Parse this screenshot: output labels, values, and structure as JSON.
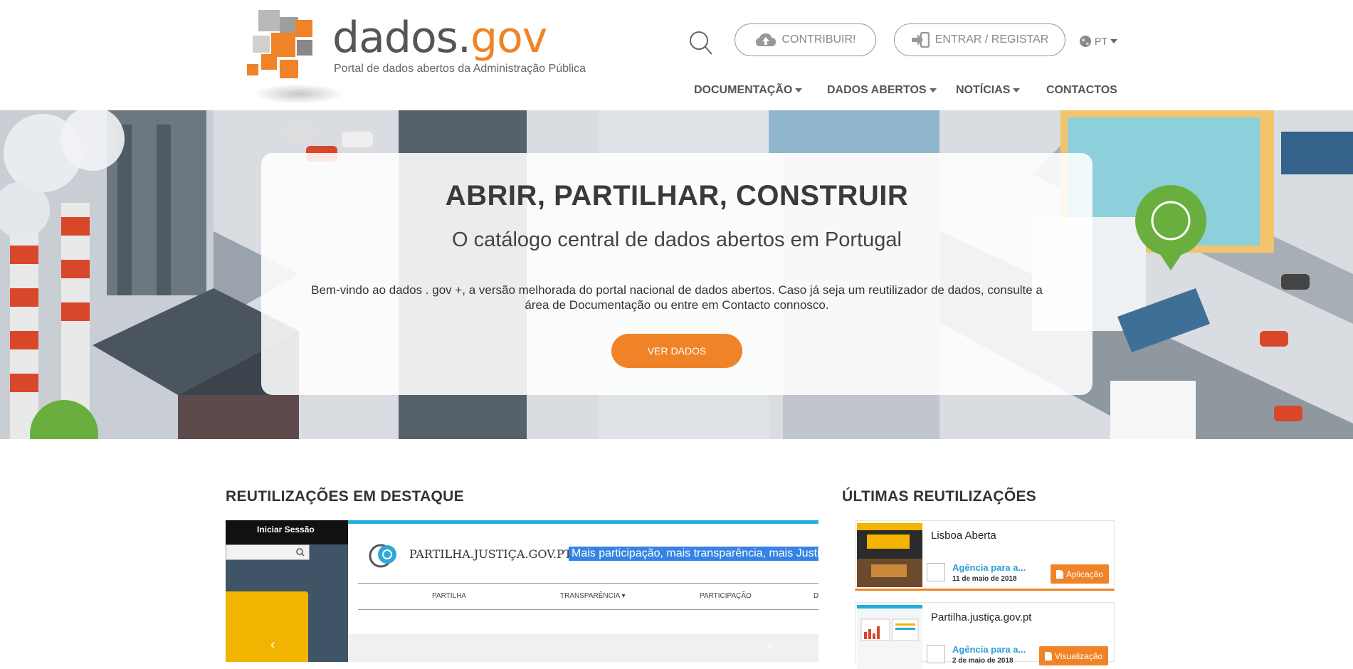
{
  "header": {
    "logo_word_main": "dados.",
    "logo_word_gov": "gov",
    "logo_tagline": "Portal de dados abertos da Administração Pública",
    "contribute_label": "CONTRIBUIR!",
    "login_label": "ENTRAR / REGISTAR",
    "language": "PT",
    "nav": [
      {
        "label": "DOCUMENTAÇÃO",
        "has_dropdown": true
      },
      {
        "label": "DADOS ABERTOS",
        "has_dropdown": true
      },
      {
        "label": "NOTÍCIAS",
        "has_dropdown": true
      },
      {
        "label": "CONTACTOS",
        "has_dropdown": false
      }
    ]
  },
  "hero": {
    "title": "ABRIR, PARTILHAR, CONSTRUIR",
    "subtitle": "O catálogo central de dados abertos em Portugal",
    "description": "Bem-vindo ao dados . gov +, a versão melhorada do portal nacional de dados abertos. Caso já seja um reutilizador de dados, consulte a área de Documentação ou entre em Contacto connosco.",
    "cta_label": "VER DADOS"
  },
  "featured": {
    "title": "REUTILIZAÇÕES EM DESTAQUE",
    "slide": {
      "login_label": "Iniciar Sessão",
      "brand": "PARTILHA.JUSTIÇA.GOV.PT",
      "highlight": "Mais participação, mais transparência, mais Justiça",
      "nav": [
        "PARTILHA",
        "TRANSPARÊNCIA ▾",
        "PARTICIPAÇÃO",
        "D"
      ]
    },
    "prev_arrow": "‹",
    "next_arrow": "›"
  },
  "latest": {
    "title": "ÚLTIMAS REUTILIZAÇÕES",
    "items": [
      {
        "name": "Lisboa Aberta",
        "org": "Agência para a...",
        "date": "11 de maio de 2018",
        "badge": "Aplicação"
      },
      {
        "name": "Partilha.justiça.gov.pt",
        "org": "Agência para a...",
        "date": "2 de maio de 2018",
        "badge": "Visualização"
      }
    ]
  },
  "colors": {
    "accent": "#f08327",
    "link": "#2a9fd8",
    "green_badge": "#6aaf3d"
  },
  "icons": [
    "search-icon",
    "cloud-upload-icon",
    "sign-in-icon",
    "globe-icon",
    "document-icon",
    "plug-icon",
    "sprout-icon"
  ]
}
